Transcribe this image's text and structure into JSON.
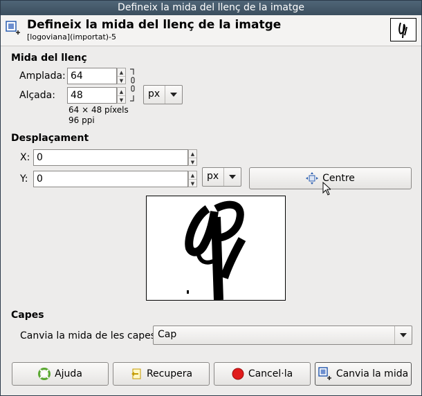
{
  "window": {
    "title": "Defineix la mida del llenç de la imatge"
  },
  "header": {
    "title": "Defineix la mida del llenç de la imatge",
    "subtitle": "[logoviana](importat)-5"
  },
  "canvas_size": {
    "section": "Mida del llenç",
    "width_label": "Amplada:",
    "width_value": "64",
    "height_label": "Alçada:",
    "height_value": "48",
    "unit": "px",
    "pixels_info": "64 × 48 píxels",
    "ppi_info": "96 ppi"
  },
  "offset": {
    "section": "Desplaçament",
    "x_label": "X:",
    "x_value": "0",
    "y_label": "Y:",
    "y_value": "0",
    "unit": "px",
    "center_label": "Centre"
  },
  "layers": {
    "section": "Capes",
    "resize_label": "Canvia la mida de les capes:",
    "resize_value": "Cap"
  },
  "buttons": {
    "help": "Ajuda",
    "reset": "Recupera",
    "cancel": "Cancel·la",
    "resize": "Canvia la mida"
  },
  "colors": {
    "titlebar": "#455a6b",
    "dialog_bg": "#edeceb",
    "cancel_red": "#e01b1b",
    "help_green": "#5aa832"
  },
  "icons": [
    "canvas-size-icon",
    "chain-link-icon",
    "dropdown-arrow-icon",
    "center-icon",
    "help-icon",
    "reset-icon",
    "cancel-icon",
    "resize-icon",
    "mouse-cursor-icon"
  ]
}
